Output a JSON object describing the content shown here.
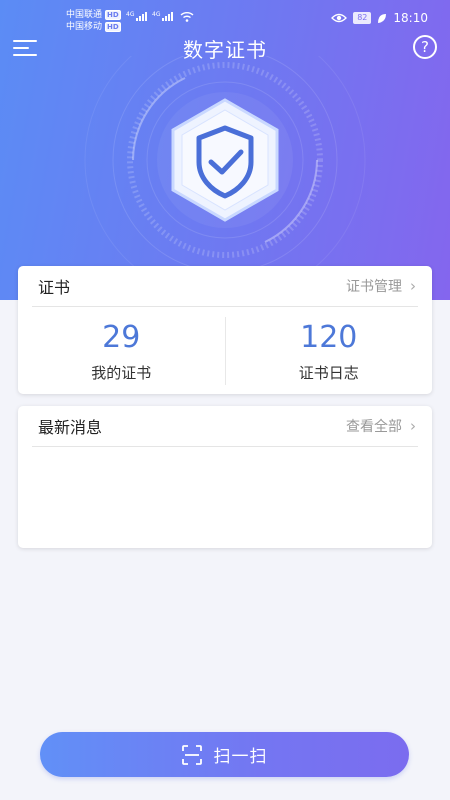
{
  "status": {
    "carrier1": "中国联通",
    "carrier2": "中国移动",
    "hd": "HD",
    "net1": "4G",
    "net2": "4G",
    "battery": "82",
    "time": "18:10"
  },
  "header": {
    "title": "数字证书",
    "help_icon": "?"
  },
  "cert_card": {
    "title": "证书",
    "manage_label": "证书管理",
    "chevron": "›",
    "stats": [
      {
        "value": "29",
        "label": "我的证书"
      },
      {
        "value": "120",
        "label": "证书日志"
      }
    ]
  },
  "news_card": {
    "title": "最新消息",
    "view_all_label": "查看全部",
    "chevron": "›"
  },
  "scan": {
    "label": "扫一扫"
  },
  "colors": {
    "accent": "#4d78d8",
    "gradient_start": "#5b8cf5",
    "gradient_end": "#8466ee"
  }
}
